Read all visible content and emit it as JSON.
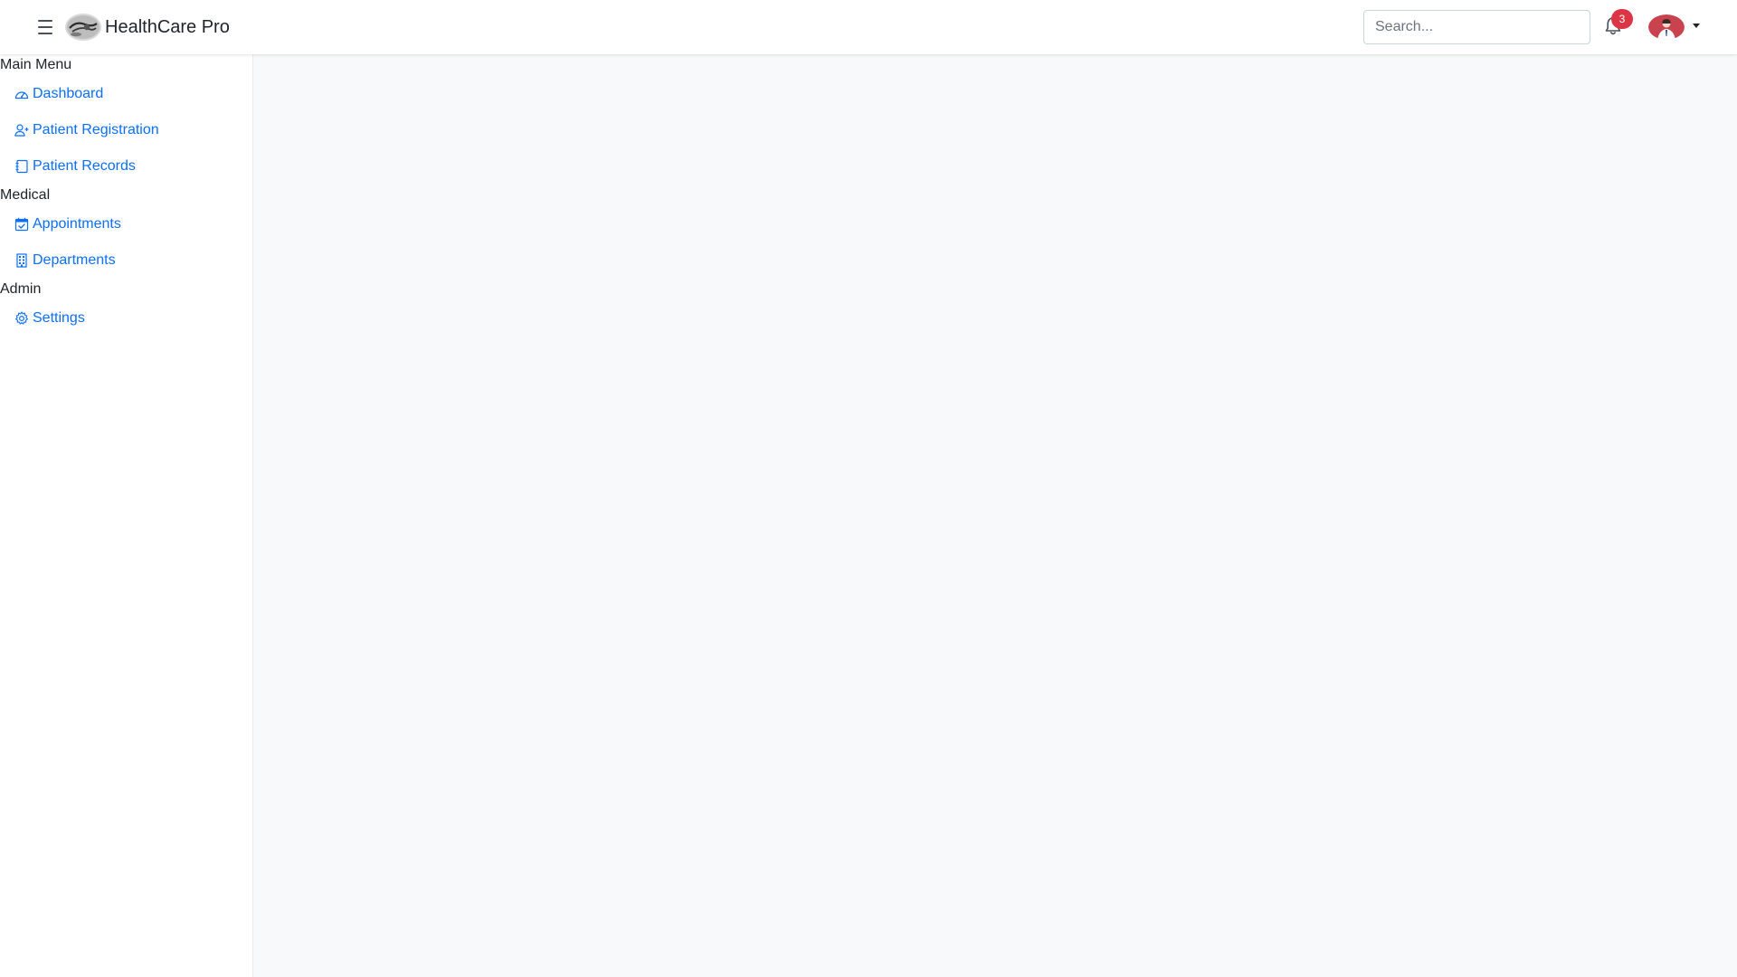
{
  "header": {
    "brand_name": "HealthCare Pro",
    "search_placeholder": "Search...",
    "notification_count": "3"
  },
  "sidebar": {
    "sections": [
      {
        "title": "Main Menu"
      },
      {
        "title": "Medical"
      },
      {
        "title": "Admin"
      }
    ],
    "items": [
      {
        "label": "Dashboard",
        "icon": "speedometer-icon"
      },
      {
        "label": "Patient Registration",
        "icon": "person-plus-icon"
      },
      {
        "label": "Patient Records",
        "icon": "journal-icon"
      },
      {
        "label": "Appointments",
        "icon": "calendar-check-icon"
      },
      {
        "label": "Departments",
        "icon": "building-icon"
      },
      {
        "label": "Settings",
        "icon": "gear-icon"
      }
    ]
  },
  "colors": {
    "link": "#0d6efd",
    "badge": "#dc3545",
    "main_background": "#f8f9fa"
  }
}
